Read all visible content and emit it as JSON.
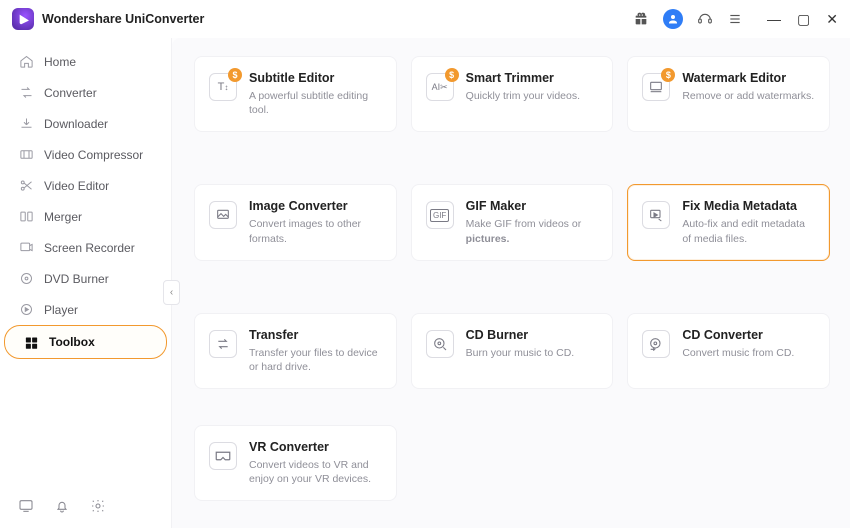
{
  "app": {
    "title": "Wondershare UniConverter"
  },
  "sidebar": {
    "items": [
      {
        "label": "Home"
      },
      {
        "label": "Converter"
      },
      {
        "label": "Downloader"
      },
      {
        "label": "Video Compressor"
      },
      {
        "label": "Video Editor"
      },
      {
        "label": "Merger"
      },
      {
        "label": "Screen Recorder"
      },
      {
        "label": "DVD Burner"
      },
      {
        "label": "Player"
      },
      {
        "label": "Toolbox"
      }
    ]
  },
  "tools": {
    "subtitle_editor": {
      "title": "Subtitle Editor",
      "desc": "A powerful subtitle editing tool.",
      "badge": "$"
    },
    "smart_trimmer": {
      "title": "Smart Trimmer",
      "desc": "Quickly trim your videos.",
      "badge": "$"
    },
    "watermark_editor": {
      "title": "Watermark Editor",
      "desc": "Remove or add watermarks.",
      "badge": "$"
    },
    "image_converter": {
      "title": "Image Converter",
      "desc": "Convert images to other formats."
    },
    "gif_maker": {
      "title": "GIF Maker",
      "desc": "Make GIF from videos or pictures."
    },
    "fix_metadata": {
      "title": "Fix Media Metadata",
      "desc": "Auto-fix and edit metadata of media files."
    },
    "transfer": {
      "title": "Transfer",
      "desc": "Transfer your files to device or hard drive."
    },
    "cd_burner": {
      "title": "CD Burner",
      "desc": "Burn your music to CD."
    },
    "cd_converter": {
      "title": "CD Converter",
      "desc": "Convert music from CD."
    },
    "vr_converter": {
      "title": "VR Converter",
      "desc": "Convert videos to VR and enjoy on your VR devices."
    }
  }
}
